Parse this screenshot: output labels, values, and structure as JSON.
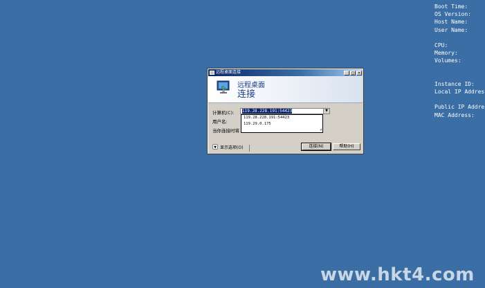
{
  "bginfo": {
    "boot_time": "Boot Time:",
    "os_version": "OS Version:",
    "host_name": "Host Name:",
    "user_name": "User Name:",
    "cpu": "CPU:",
    "memory": "Memory:",
    "volumes": "Volumes:",
    "instance_id": "Instance ID:",
    "local_ip": "Local IP Address:",
    "public_ip": "Public IP Address:",
    "mac": "MAC Address:"
  },
  "dialog": {
    "title": "远程桌面连接",
    "banner_line1": "远程桌面",
    "banner_line2": "连接",
    "computer_label": "计算机(C):",
    "computer_value": "119.28.228.191:54423",
    "username_label": "用户名:",
    "hint_text": "当你连接时将",
    "history": [
      "119.28.228.191:54423",
      "119.29.0.175"
    ],
    "options_label": "显示选项(O)",
    "connect_label": "连接(N)",
    "help_label": "帮助(H)",
    "minimize_glyph": "_",
    "maximize_glyph": "□",
    "close_glyph": "×"
  },
  "watermark": "www.hkt4.com",
  "colors": {
    "desktop": "#3a6ea5",
    "titlebar_start": "#0a246a",
    "dialog_face": "#d4d0c8"
  }
}
